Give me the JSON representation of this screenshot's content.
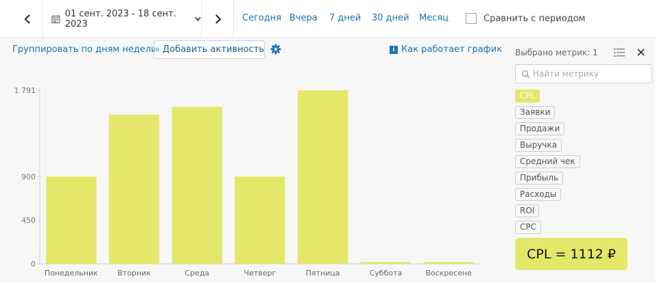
{
  "topbar": {
    "date_range": "01 сент. 2023 - 18 сент. 2023",
    "periods": [
      "Сегодня",
      "Вчера",
      "7 дней",
      "30 дней",
      "Месяц"
    ],
    "compare_label": "Сравнить с периодом",
    "compare_checked": false
  },
  "toolbar": {
    "group_by": "Группировать по дням недели",
    "add_activity": "Добавить активность",
    "how_chart_works": "Как работает график"
  },
  "panel": {
    "title": "Выбрано метрик: 1",
    "search_placeholder": "Найти метрику",
    "metrics": [
      {
        "label": "CPL",
        "active": true
      },
      {
        "label": "Заявки",
        "active": false
      },
      {
        "label": "Продажи",
        "active": false
      },
      {
        "label": "Выручка",
        "active": false
      },
      {
        "label": "Средний чек",
        "active": false
      },
      {
        "label": "Прибыль",
        "active": false
      },
      {
        "label": "Расходы",
        "active": false
      },
      {
        "label": "ROI",
        "active": false
      },
      {
        "label": "CPC",
        "active": false
      }
    ],
    "tooltip": "CPL = 1112 ₽"
  },
  "colors": {
    "bar": "#e3e86a",
    "link": "#1a73b5"
  },
  "chart_data": {
    "type": "bar",
    "categories": [
      "Понедельник",
      "Вторник",
      "Среда",
      "Четверг",
      "Пятница",
      "Суббота",
      "Воскресене"
    ],
    "values": [
      900,
      1540,
      1620,
      900,
      1791,
      20,
      20
    ],
    "y_ticks": [
      0,
      450,
      900,
      1791
    ],
    "y_tick_labels": [
      "0",
      "450",
      "900",
      "1 791"
    ],
    "ylim": [
      0,
      1791
    ],
    "grid": false
  }
}
